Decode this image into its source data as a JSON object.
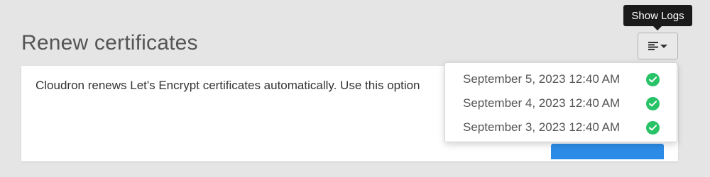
{
  "section": {
    "title": "Renew certificates"
  },
  "tooltip": {
    "text": "Show Logs"
  },
  "card": {
    "description": "Cloudron renews Let's Encrypt certificates automatically. Use this option"
  },
  "logs_menu": {
    "items": [
      {
        "date": "September 5, 2023 12:40 AM",
        "status": "success",
        "status_icon": "check-circle-icon"
      },
      {
        "date": "September 4, 2023 12:40 AM",
        "status": "success",
        "status_icon": "check-circle-icon"
      },
      {
        "date": "September 3, 2023 12:40 AM",
        "status": "success",
        "status_icon": "check-circle-icon"
      }
    ]
  },
  "colors": {
    "success": "#27c366",
    "primary": "#2b8be6",
    "tooltip_bg": "#1a1a1a"
  }
}
